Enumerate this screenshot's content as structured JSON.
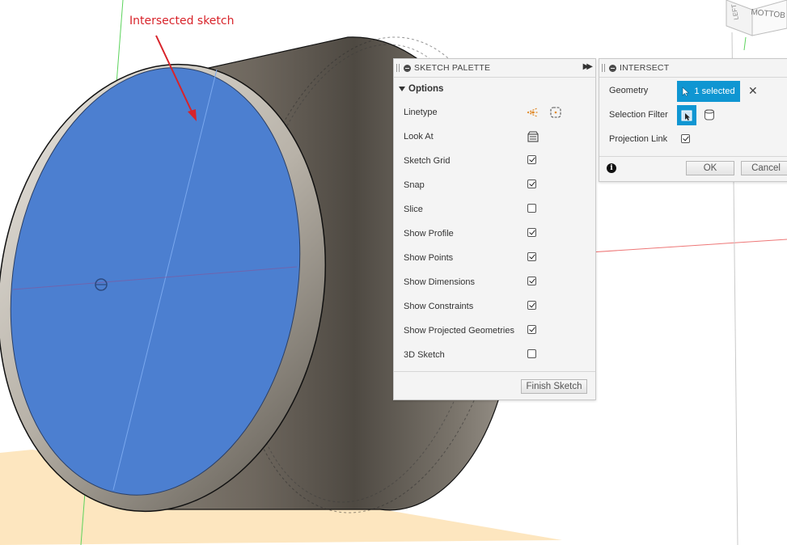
{
  "annotation": {
    "text": "Intersected sketch"
  },
  "view_cube": {
    "face_front": "MOTTOB",
    "face_left": "LEFT"
  },
  "sketch_palette": {
    "title": "SKETCH PALETTE",
    "section_label": "Options",
    "rows": [
      {
        "label": "Linetype",
        "control": "linetype-icons"
      },
      {
        "label": "Look At",
        "control": "look-at-icon"
      },
      {
        "label": "Sketch Grid",
        "checked": true
      },
      {
        "label": "Snap",
        "checked": true
      },
      {
        "label": "Slice",
        "checked": false
      },
      {
        "label": "Show Profile",
        "checked": true
      },
      {
        "label": "Show Points",
        "checked": true
      },
      {
        "label": "Show Dimensions",
        "checked": true
      },
      {
        "label": "Show Constraints",
        "checked": true
      },
      {
        "label": "Show Projected Geometries",
        "checked": true
      },
      {
        "label": "3D Sketch",
        "checked": false
      }
    ],
    "finish_label": "Finish Sketch"
  },
  "intersect": {
    "title": "INTERSECT",
    "geometry_label": "Geometry",
    "geometry_value": "1 selected",
    "filter_label": "Selection Filter",
    "projection_label": "Projection Link",
    "projection_checked": true,
    "ok_label": "OK",
    "cancel_label": "Cancel"
  },
  "colors": {
    "accent": "#0f96d2",
    "sketch_fill": "#4c7fd0",
    "annotation": "#d8232a",
    "ground": "#fde2b4"
  }
}
